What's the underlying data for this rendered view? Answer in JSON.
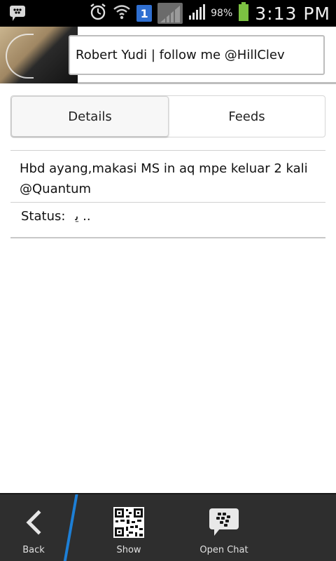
{
  "status_bar": {
    "notification_badge": "1",
    "battery_percent": "98%",
    "time": "3:13 PM",
    "icons": [
      "bbm-chat-icon",
      "alarm-icon",
      "wifi-icon",
      "sync-badge-icon",
      "signal-icon",
      "battery-icon"
    ]
  },
  "header": {
    "name": "Robert Yudi | follow me @HillClev"
  },
  "tabs": [
    {
      "label": "Details",
      "active": true
    },
    {
      "label": "Feeds",
      "active": false
    }
  ],
  "details": {
    "message": "Hbd ayang,makasi MS in aq mpe keluar 2 kali @Quantum",
    "status_label": "Status:",
    "status_value": "ﯾ .."
  },
  "bottom_bar": {
    "back_label": "Back",
    "show_label": "Show",
    "open_chat_label": "Open Chat"
  },
  "colors": {
    "status_bar_bg": "#000000",
    "bottom_bar_bg": "#2e2e2e",
    "accent_blue": "#1d7fd6",
    "battery_green": "#7cc142"
  }
}
